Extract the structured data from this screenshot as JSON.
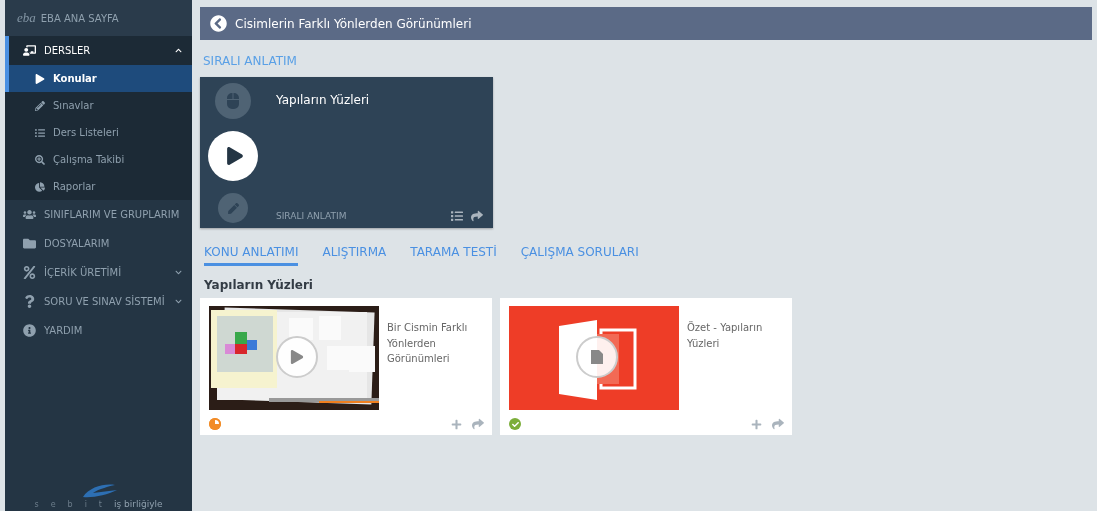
{
  "sidebar": {
    "home": {
      "logo": "eba",
      "label": "EBA ANA SAYFA"
    },
    "items": [
      {
        "label": "DERSLER",
        "expandable": true,
        "expanded": true,
        "children": [
          {
            "label": "Konular",
            "selected": true
          },
          {
            "label": "Sınavlar",
            "selected": false
          },
          {
            "label": "Ders Listeleri",
            "selected": false
          },
          {
            "label": "Çalışma Takibi",
            "selected": false
          },
          {
            "label": "Raporlar",
            "selected": false
          }
        ]
      },
      {
        "label": "SINIFLARIM VE GRUPLARIM",
        "expandable": false,
        "expanded": false
      },
      {
        "label": "DOSYALARIM",
        "expandable": false,
        "expanded": false
      },
      {
        "label": "İÇERİK ÜRETİMİ",
        "expandable": true,
        "expanded": false
      },
      {
        "label": "SORU VE SINAV SİSTEMİ",
        "expandable": true,
        "expanded": false
      },
      {
        "label": "YARDIM",
        "expandable": false,
        "expanded": false
      }
    ],
    "footer": {
      "letters": [
        "s",
        "e",
        "b",
        "i",
        "t"
      ],
      "text": "iş birliğiyle"
    }
  },
  "header": {
    "title": "Cisimlerin Farklı Yönlerden Görünümleri"
  },
  "sequence": {
    "heading": "SIRALI ANLATIM",
    "card": {
      "title": "Yapıların Yüzleri",
      "caption": "SIRALI ANLATIM"
    }
  },
  "tabs": [
    {
      "label": "KONU ANLATIMI",
      "selected": true
    },
    {
      "label": "ALIŞTIRMA",
      "selected": false
    },
    {
      "label": "TARAMA TESTİ",
      "selected": false
    },
    {
      "label": "ÇALIŞMA SORULARI",
      "selected": false
    }
  ],
  "section": {
    "title": "Yapıların Yüzleri",
    "items": [
      {
        "kind": "video",
        "title": "Bir Cismin Farklı Yönlerden Görünümleri",
        "completed": false
      },
      {
        "kind": "presentation",
        "title": "Özet - Yapıların Yüzleri",
        "completed": true
      }
    ]
  }
}
